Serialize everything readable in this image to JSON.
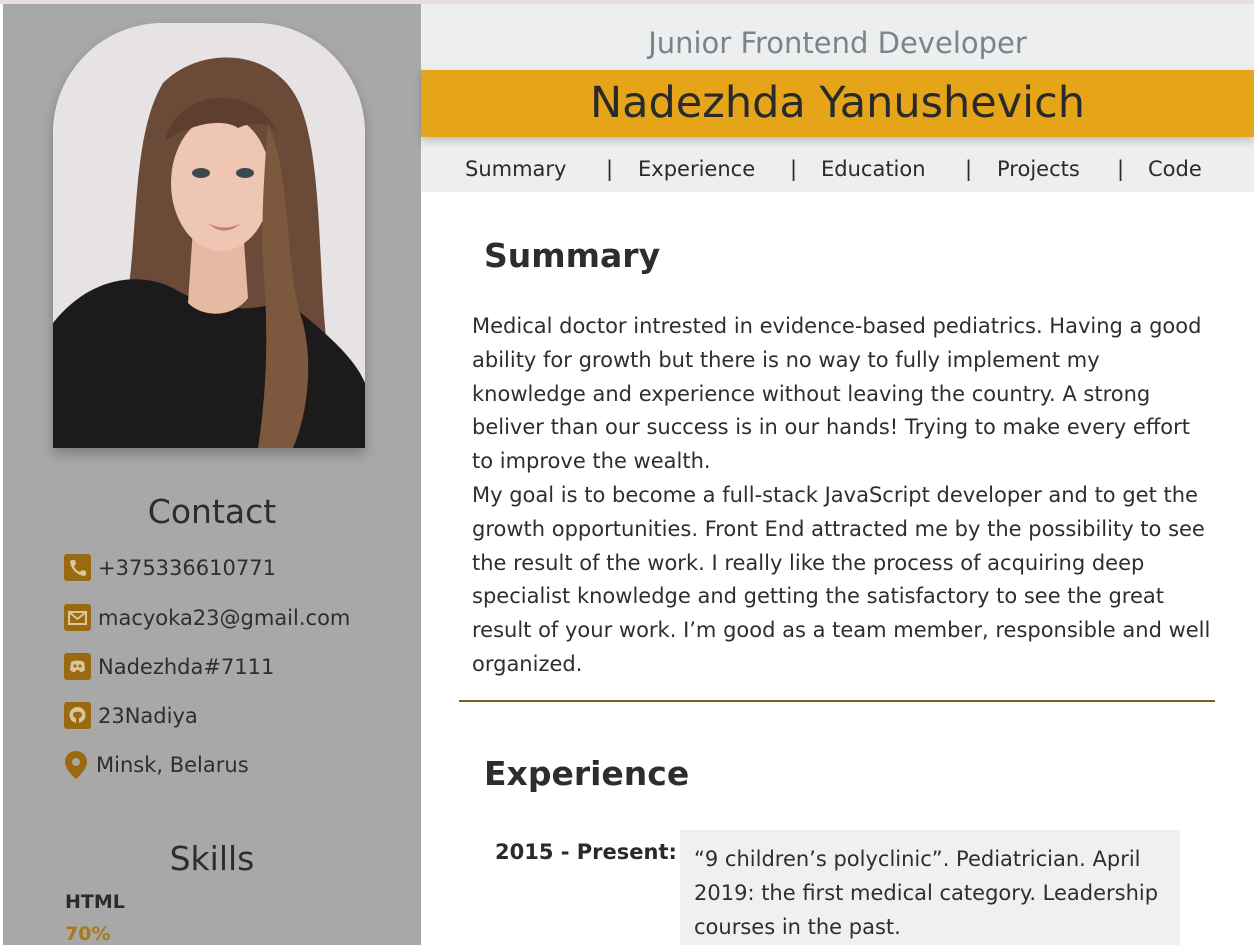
{
  "header": {
    "role": "Junior Frontend Developer",
    "name": "Nadezhda Yanushevich",
    "nav": [
      "Summary",
      "|",
      "Experience",
      "|",
      "Education",
      "|",
      "Projects",
      "|",
      "Code"
    ]
  },
  "sidebar": {
    "contact_title": "Contact",
    "contacts": [
      {
        "icon": "phone-icon",
        "text": "+375336610771"
      },
      {
        "icon": "envelope-icon",
        "text": "macyoka23@gmail.com"
      },
      {
        "icon": "discord-icon",
        "text": "Nadezhda#7111"
      },
      {
        "icon": "github-icon",
        "text": "23Nadiya"
      },
      {
        "icon": "location-pin-icon",
        "text": "Minsk, Belarus"
      }
    ],
    "skills_title": "Skills",
    "skills": [
      {
        "name": "HTML",
        "percent": "70%"
      }
    ]
  },
  "summary": {
    "title": "Summary",
    "paragraphs": [
      "Medical doctor intrested in evidence-based pediatrics. Having a good ability for growth but there is no way to fully implement my knowledge and experience without leaving the country. A strong beliver than our success is in our hands! Trying to make every effort to improve the wealth.",
      "My goal is to become a full-stack JavaScript developer and to get the growth opportunities. Front End attracted me by the possibility to see the result of the work. I really like the process of acquiring deep specialist knowledge and getting the satisfactory to see the great result of your work. I’m good as a team member, responsible and well organized."
    ]
  },
  "experience": {
    "title": "Experience",
    "items": [
      {
        "date": "2015 - Present:",
        "description": "“9 children’s polyclinic”. Pediatrician. April 2019: the first medical category. Leadership courses in the past."
      }
    ]
  },
  "colors": {
    "accent": "#e6a519",
    "icon": "#9b6a10",
    "sidebar_bg": "#a8a8a8",
    "header_bg": "#eceef0",
    "divider": "#7a6420"
  }
}
